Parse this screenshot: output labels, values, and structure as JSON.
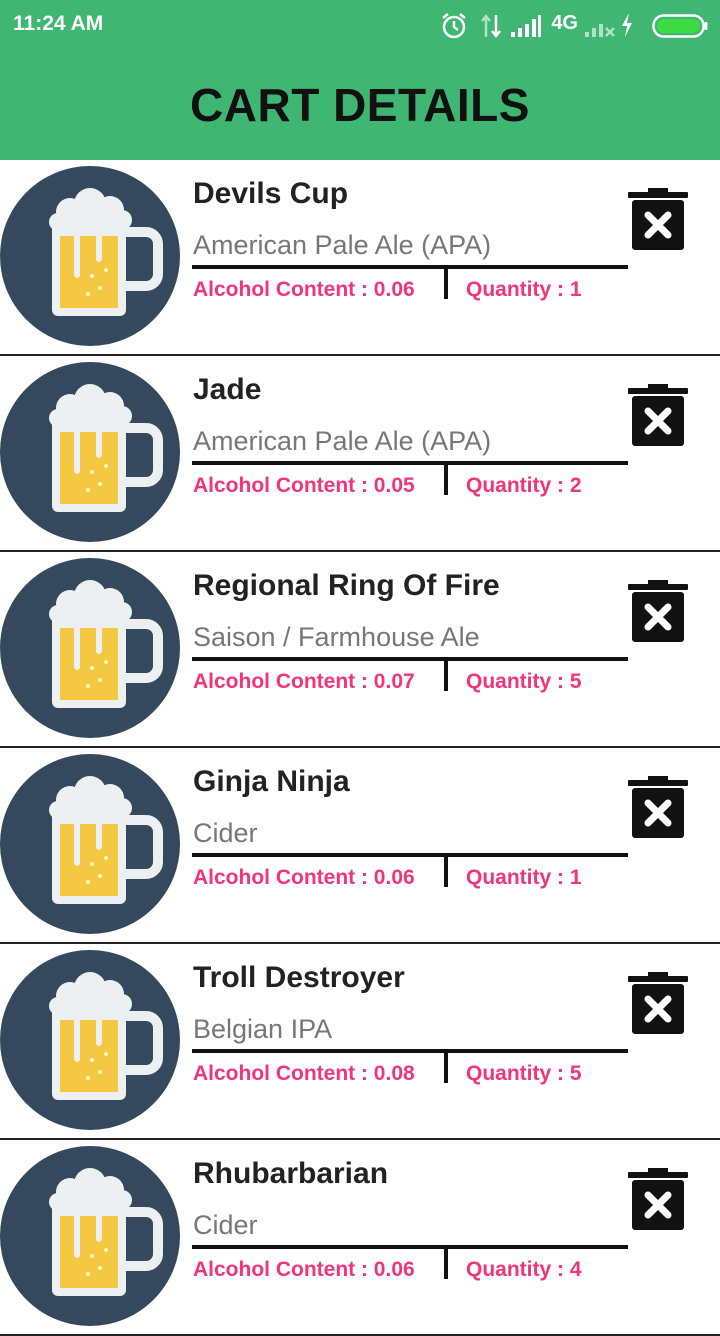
{
  "status_bar": {
    "time": "11:24 AM",
    "network": "4G",
    "icons": [
      "alarm-icon",
      "data-transfer-icon",
      "signal-icon",
      "signal-weak-icon",
      "charging-icon",
      "battery-icon"
    ]
  },
  "header": {
    "title": "CART DETAILS"
  },
  "colors": {
    "accent": "#3fb672",
    "highlight_text": "#f2357a",
    "avatar_bg": "#34495e",
    "beer": "#f4c842"
  },
  "labels": {
    "alcohol_prefix": "Alcohol Content : ",
    "quantity_prefix": "Quantity : "
  },
  "cart_items": [
    {
      "name": "Devils Cup",
      "style": "American Pale Ale (APA)",
      "alcohol": "Alcohol Content : 0.06",
      "quantity": "Quantity : 1"
    },
    {
      "name": "Jade",
      "style": "American Pale Ale (APA)",
      "alcohol": "Alcohol Content : 0.05",
      "quantity": "Quantity : 2"
    },
    {
      "name": "Regional Ring Of Fire",
      "style": "Saison / Farmhouse Ale",
      "alcohol": "Alcohol Content : 0.07",
      "quantity": "Quantity : 5"
    },
    {
      "name": "Ginja Ninja",
      "style": "Cider",
      "alcohol": "Alcohol Content : 0.06",
      "quantity": "Quantity : 1"
    },
    {
      "name": "Troll Destroyer",
      "style": "Belgian IPA",
      "alcohol": "Alcohol Content : 0.08",
      "quantity": "Quantity : 5"
    },
    {
      "name": "Rhubarbarian",
      "style": "Cider",
      "alcohol": "Alcohol Content : 0.06",
      "quantity": "Quantity : 4"
    }
  ]
}
